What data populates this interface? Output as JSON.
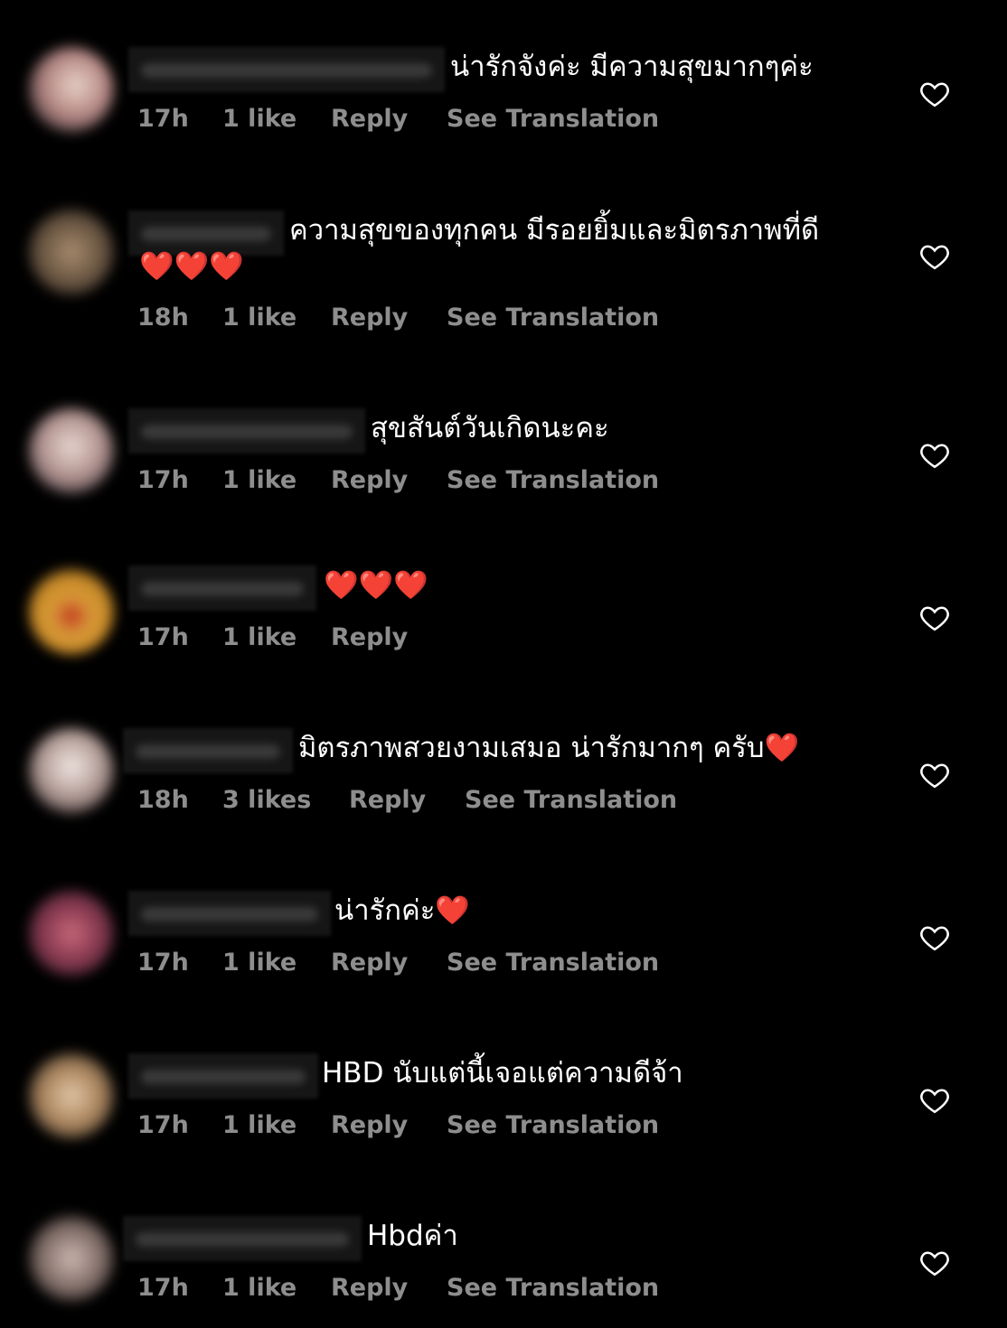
{
  "comments": [
    {
      "text": "น่ารักจังค่ะ มีความสุขมากๆค่ะ",
      "time": "17h",
      "likes": "1 like",
      "reply": "Reply",
      "translate": "See Translation"
    },
    {
      "text": "ความสุขของทุกคน มีรอยยิ้มและมิตรภาพที่ดี",
      "text2": "❤️❤️❤️",
      "time": "18h",
      "likes": "1 like",
      "reply": "Reply",
      "translate": "See Translation"
    },
    {
      "text": "สุขสันต์วันเกิดนะคะ",
      "time": "17h",
      "likes": "1 like",
      "reply": "Reply",
      "translate": "See Translation"
    },
    {
      "text": "❤️❤️❤️",
      "time": "17h",
      "likes": "1 like",
      "reply": "Reply"
    },
    {
      "text": "มิตรภาพสวยงามเสมอ น่ารักมากๆ ครับ❤️",
      "time": "18h",
      "likes": "3 likes",
      "reply": "Reply",
      "translate": "See Translation"
    },
    {
      "text": "น่ารักค่ะ❤️",
      "time": "17h",
      "likes": "1 like",
      "reply": "Reply",
      "translate": "See Translation"
    },
    {
      "text": "HBD นับแต่นี้เจอแต่ความดีจ้า",
      "time": "17h",
      "likes": "1 like",
      "reply": "Reply",
      "translate": "See Translation"
    },
    {
      "text": "Hbdค่า",
      "time": "17h",
      "likes": "1 like",
      "reply": "Reply",
      "translate": "See Translation"
    }
  ],
  "icons": {
    "like": "heart-outline-icon"
  },
  "colors": {
    "background": "#000000",
    "meta_text": "#8e8e8e",
    "text": "#ffffff"
  }
}
